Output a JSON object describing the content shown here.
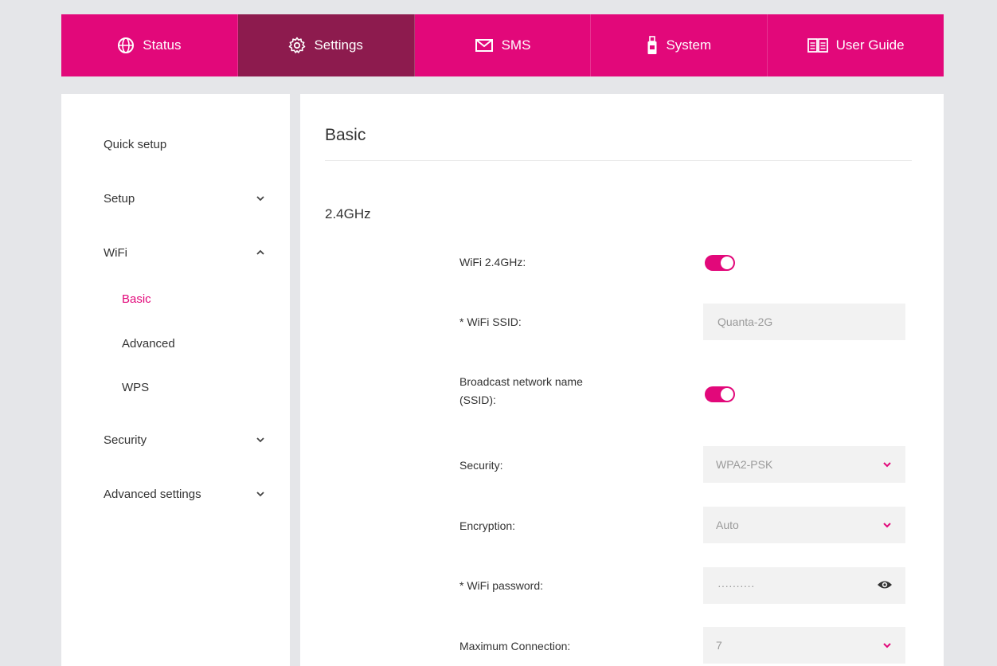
{
  "nav": {
    "tabs": [
      {
        "label": "Status",
        "icon": "globe-icon"
      },
      {
        "label": "Settings",
        "icon": "gear-icon"
      },
      {
        "label": "SMS",
        "icon": "envelope-icon"
      },
      {
        "label": "System",
        "icon": "usb-device-icon"
      },
      {
        "label": "User Guide",
        "icon": "book-icon"
      }
    ],
    "active": "Settings"
  },
  "sidebar": {
    "items": [
      {
        "label": "Quick setup"
      },
      {
        "label": "Setup",
        "chevron": "down"
      },
      {
        "label": "WiFi",
        "chevron": "up"
      },
      {
        "label": "Security",
        "chevron": "down"
      },
      {
        "label": "Advanced settings",
        "chevron": "down"
      }
    ],
    "wifi_subitems": [
      {
        "label": "Basic",
        "active": true
      },
      {
        "label": "Advanced"
      },
      {
        "label": "WPS"
      }
    ]
  },
  "main": {
    "title": "Basic",
    "section": "2.4GHz",
    "fields": {
      "wifi_24": {
        "label": "WiFi 2.4GHz:",
        "enabled": true
      },
      "ssid": {
        "label": "* WiFi SSID:",
        "value": "Quanta-2G"
      },
      "broadcast": {
        "label_line1": "Broadcast network name",
        "label_line2": "(SSID):",
        "enabled": true
      },
      "security": {
        "label": "Security:",
        "value": "WPA2-PSK"
      },
      "encryption": {
        "label": "Encryption:",
        "value": "Auto"
      },
      "password": {
        "label": "* WiFi password:",
        "value": "··········"
      },
      "max_conn": {
        "label": "Maximum Connection:",
        "value": "7"
      }
    }
  },
  "colors": {
    "accent": "#e2087a",
    "active_tab": "#8d1b4e",
    "background": "#e5e6e9"
  }
}
